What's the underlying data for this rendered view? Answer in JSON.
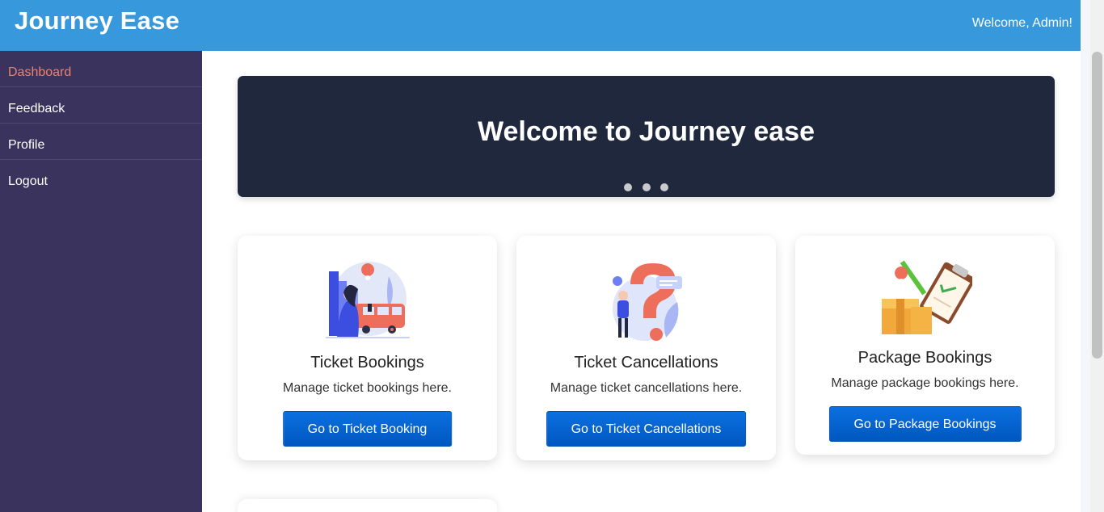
{
  "header": {
    "brand": "Journey Ease",
    "welcome": "Welcome, Admin!"
  },
  "sidebar": {
    "items": [
      {
        "label": "Dashboard",
        "active": true
      },
      {
        "label": "Feedback"
      },
      {
        "label": "Profile"
      },
      {
        "label": "Logout"
      }
    ]
  },
  "hero": {
    "title": "Welcome to Journey ease",
    "slide_count": 3
  },
  "cards": [
    {
      "title": "Ticket Bookings",
      "description": "Manage ticket bookings here.",
      "button": "Go to Ticket Booking",
      "icon": "ticket-booking-illustration"
    },
    {
      "title": "Ticket Cancellations",
      "description": "Manage ticket cancellations here.",
      "button": "Go to Ticket Cancellations",
      "icon": "question-mark-illustration"
    },
    {
      "title": "Package Bookings",
      "description": "Manage package bookings here.",
      "button": "Go to Package Bookings",
      "icon": "package-clipboard-illustration"
    }
  ],
  "colors": {
    "header": "#3799db",
    "sidebar": "#3a335e",
    "active_nav": "#e9836f",
    "hero": "#1f283d",
    "button": "#0b70e0"
  }
}
